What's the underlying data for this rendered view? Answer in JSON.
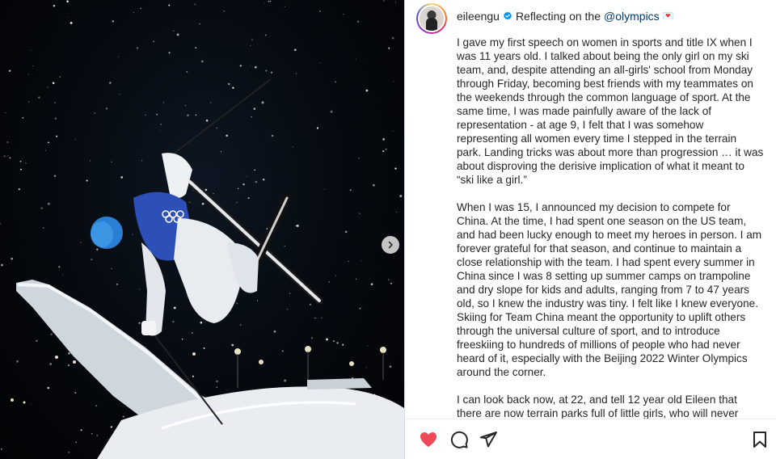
{
  "post": {
    "username": "eileengu",
    "caption_lead": "Reflecting on the",
    "mention": "@olympics",
    "emoji": "💌",
    "paragraphs": [
      "I gave my first speech on women in sports and title IX when I was 11 years old. I talked about being the only girl on my ski team, and, despite attending an all-girls' school from Monday through Friday, becoming best friends with my teammates on the weekends through the common language of sport. At the same time, I was made painfully aware of the lack of representation - at age 9, I felt that I was somehow representing all women every time I stepped in the terrain park. Landing tricks was about more than progression … it was about disproving the derisive implication of what it meant to “ski like a girl.”",
      "When I was 15, I announced my decision to compete for China. At the time, I had spent one season on the US team, and had been lucky enough to meet my heroes in person. I am forever grateful for that season, and continue to maintain a close relationship with the team. I had spent every summer in China since I was 8 setting up summer camps on trampoline and dry slope for kids and adults, ranging from 7 to 47 years old, so I knew the industry was tiny. I felt like I knew everyone. Skiing for Team China meant the opportunity to uplift others through the universal culture of sport, and to introduce freeskiing to hundreds of millions of people who had never heard of it, especially with the Beijing 2022 Winter Olympics around the corner.",
      "I can look back now, at 22, and tell 12 year old Eileen that there are now terrain parks full of little girls, who will never"
    ]
  },
  "icons": {
    "verified": "verified-badge-icon",
    "next": "chevron-right-icon",
    "like": "heart-icon",
    "comment": "comment-bubble-icon",
    "share": "paper-plane-icon",
    "save": "bookmark-icon"
  },
  "colors": {
    "like_active": "#ed4956",
    "mention": "#00376b",
    "verified": "#0095f6"
  }
}
